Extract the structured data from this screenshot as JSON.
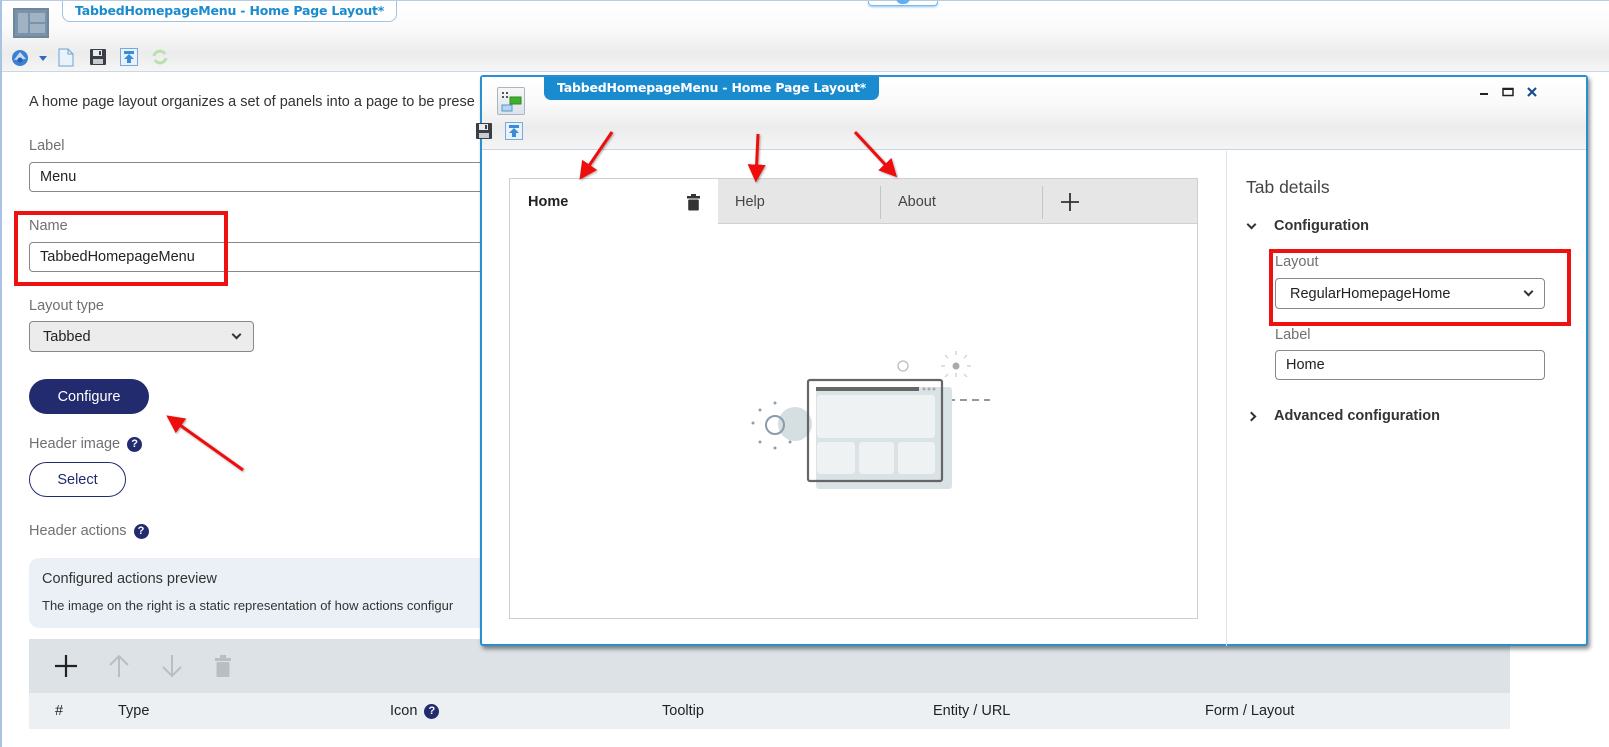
{
  "app": {
    "window_title": "TabbedHomepageMenu - Home Page Layout*",
    "toolbar": [
      {
        "name": "app-menu-icon",
        "glyph": "app-logo"
      },
      {
        "name": "dropdown-arrow-icon",
        "glyph": "caret-down"
      },
      {
        "name": "new-document-icon",
        "glyph": "page"
      },
      {
        "name": "save-icon",
        "glyph": "floppy-disk"
      },
      {
        "name": "deploy-icon",
        "glyph": "upload-arrow"
      },
      {
        "name": "refresh-icon",
        "glyph": "refresh-disabled"
      }
    ]
  },
  "form": {
    "intro": "A home page layout organizes a set of panels into a page to be prese",
    "label_field": {
      "label": "Label",
      "value": "Menu"
    },
    "name_field": {
      "label": "Name",
      "value": "TabbedHomepageMenu"
    },
    "layout_type": {
      "label": "Layout type",
      "value": "Tabbed"
    },
    "configure_button": "Configure",
    "header_image": {
      "label": "Header image",
      "help": "?",
      "select_button": "Select"
    },
    "header_actions": {
      "label": "Header actions",
      "help": "?",
      "preview_title": "Configured actions preview",
      "preview_desc": "The image on the right is a static representation of how actions configur",
      "toolbar": [
        {
          "name": "add-icon",
          "glyph": "+",
          "enabled": true
        },
        {
          "name": "move-up-icon",
          "glyph": "↑",
          "enabled": false
        },
        {
          "name": "move-down-icon",
          "glyph": "↓",
          "enabled": false
        },
        {
          "name": "delete-icon",
          "glyph": "trash",
          "enabled": false
        }
      ],
      "columns": [
        "#",
        "Type",
        "Icon",
        "Tooltip",
        "Entity / URL",
        "Form / Layout"
      ],
      "icon_help": "?"
    }
  },
  "modal": {
    "title": "TabbedHomepageMenu - Home Page Layout*",
    "window_controls": {
      "minimize": "minimize",
      "maximize": "maximize",
      "close": "close"
    },
    "tabs": [
      {
        "label": "Home",
        "active": true,
        "has_delete": true
      },
      {
        "label": "Help",
        "active": false
      },
      {
        "label": "About",
        "active": false
      }
    ],
    "add_tab_glyph": "+",
    "tab_details": {
      "title": "Tab details",
      "configuration": {
        "header": "Configuration",
        "expanded": true,
        "layout": {
          "label": "Layout",
          "value": "RegularHomepageHome"
        },
        "label": {
          "label": "Label",
          "value": "Home"
        }
      },
      "advanced": {
        "header": "Advanced configuration",
        "expanded": false
      }
    }
  },
  "colors": {
    "accent_blue": "#1b8bd0",
    "primary_button": "#222b6e",
    "annotation_red": "#ee1111"
  }
}
